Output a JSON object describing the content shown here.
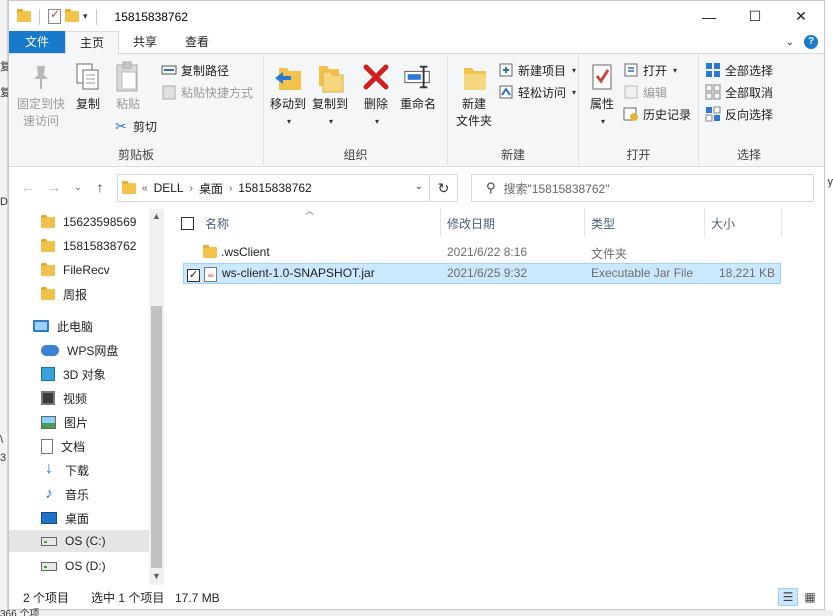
{
  "window": {
    "title": "15815838762",
    "minimize_glyph": "—",
    "maximize_glyph": "☐",
    "close_glyph": "✕"
  },
  "ribbon_tabs": [
    {
      "label": "文件"
    },
    {
      "label": "主页"
    },
    {
      "label": "共享"
    },
    {
      "label": "查看"
    }
  ],
  "clipboard": {
    "group": "剪贴板",
    "pin_l1": "固定到快",
    "pin_l2": "速访问",
    "copy": "复制",
    "paste": "粘贴",
    "copy_path": "复制路径",
    "paste_shortcut": "粘贴快捷方式",
    "cut": "剪切"
  },
  "organize": {
    "group": "组织",
    "move_to": "移动到",
    "copy_to": "复制到",
    "delete": "删除",
    "rename": "重命名"
  },
  "new_group": {
    "group": "新建",
    "new_folder_l1": "新建",
    "new_folder_l2": "文件夹",
    "new_item": "新建项目",
    "easy_access": "轻松访问"
  },
  "open_group": {
    "group": "打开",
    "properties": "属性",
    "open": "打开",
    "edit": "编辑",
    "history": "历史记录"
  },
  "select_group": {
    "group": "选择",
    "select_all": "全部选择",
    "select_none": "全部取消",
    "invert": "反向选择"
  },
  "address": {
    "chevrons": "«",
    "crumbs": [
      "DELL",
      "桌面",
      "15815838762"
    ],
    "search_placeholder": "搜索\"15815838762\""
  },
  "nav_items": [
    {
      "label": "15623598569",
      "icon": "folder-icon"
    },
    {
      "label": "15815838762",
      "icon": "folder-icon"
    },
    {
      "label": "FileRecv",
      "icon": "folder-icon"
    },
    {
      "label": "周报",
      "icon": "folder-icon"
    },
    {
      "label": "此电脑",
      "icon": "pc-icon"
    },
    {
      "label": "WPS网盘",
      "icon": "cloud-icon"
    },
    {
      "label": "3D 对象",
      "icon": "cube-icon"
    },
    {
      "label": "视频",
      "icon": "video-icon"
    },
    {
      "label": "图片",
      "icon": "pictures-icon"
    },
    {
      "label": "文档",
      "icon": "documents-icon"
    },
    {
      "label": "下载",
      "icon": "download-icon"
    },
    {
      "label": "音乐",
      "icon": "music-icon"
    },
    {
      "label": "桌面",
      "icon": "desktop-icon"
    },
    {
      "label": "OS (C:)",
      "icon": "drive-icon"
    },
    {
      "label": "OS (D:)",
      "icon": "drive-icon"
    }
  ],
  "columns": {
    "name": "名称",
    "modified": "修改日期",
    "type": "类型",
    "size": "大小"
  },
  "files": [
    {
      "name": ".wsClient",
      "modified": "2021/6/22 8:16",
      "type": "文件夹",
      "size": ""
    },
    {
      "name": "ws-client-1.0-SNAPSHOT.jar",
      "modified": "2021/6/25 9:32",
      "type": "Executable Jar File",
      "size": "18,221 KB"
    }
  ],
  "status": {
    "item_count": "2 个项目",
    "selection": "选中 1 个项目",
    "selection_size": "17.7 MB"
  },
  "background": {
    "left_chars": [
      "复",
      "复",
      "D",
      "\\",
      "3"
    ],
    "right_char": "y",
    "bottom_text": "366 个项"
  }
}
